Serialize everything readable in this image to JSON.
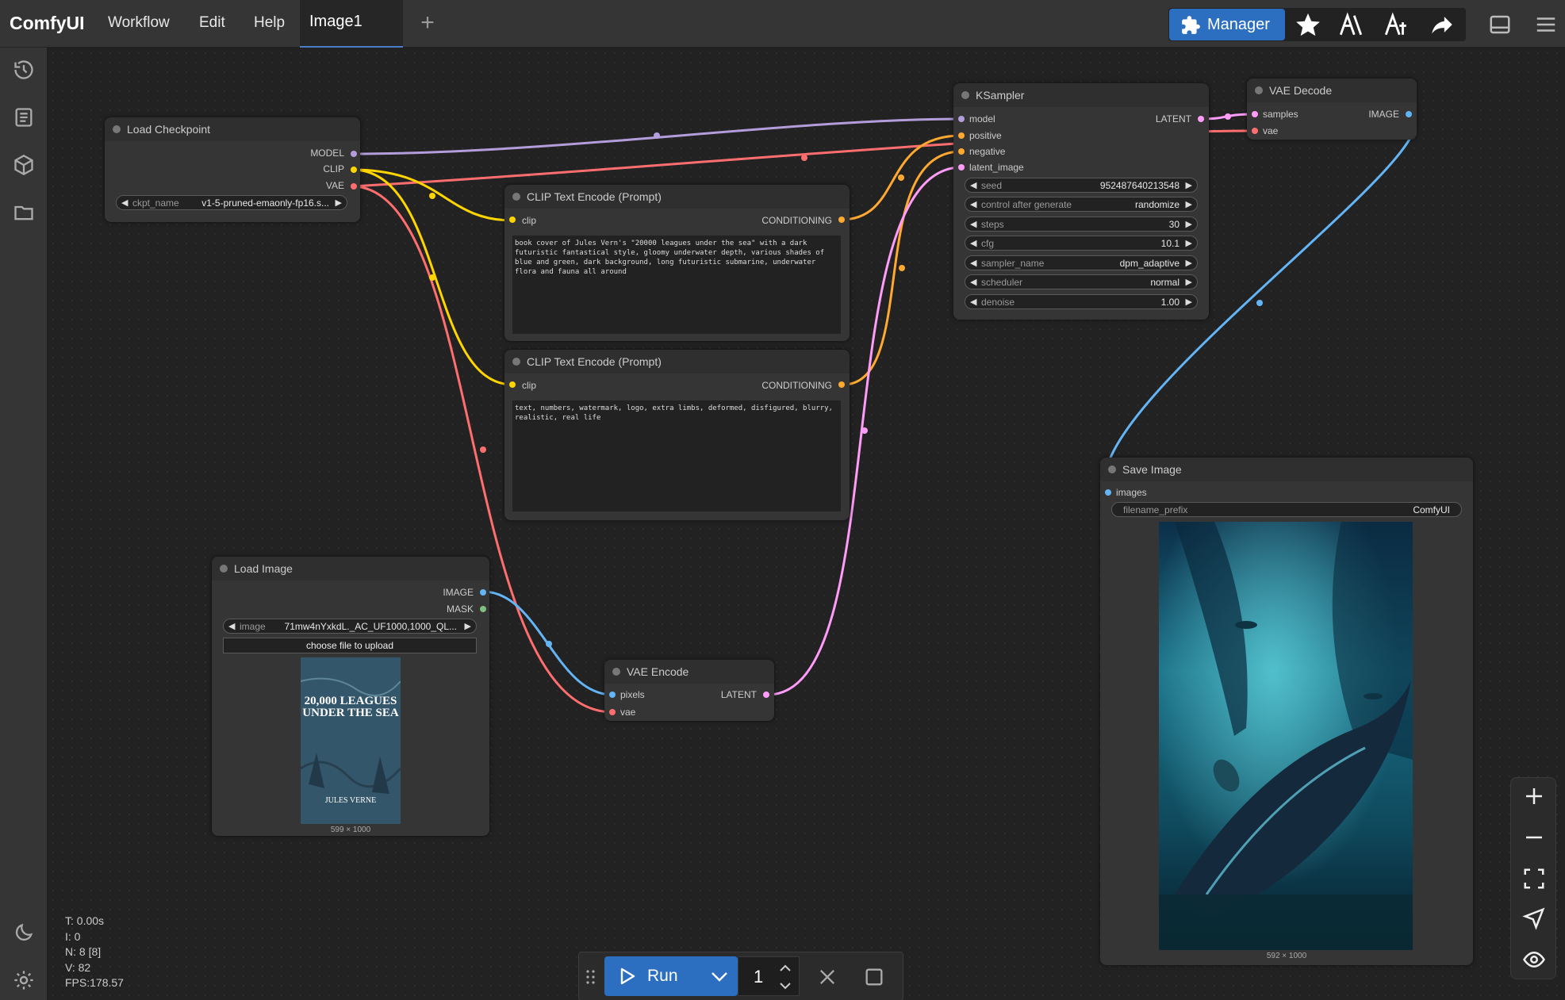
{
  "app": {
    "title": "ComfyUI"
  },
  "menu": [
    "Workflow",
    "Edit",
    "Help"
  ],
  "tabs": [
    {
      "label": "Image1"
    }
  ],
  "toolbar": {
    "manager_label": "Manager"
  },
  "colors": {
    "model": "#b39ddb",
    "clip": "#ffd500",
    "vae": "#ff6e6e",
    "conditioning": "#ffa931",
    "latent": "#ff9cf9",
    "image": "#64b5f6",
    "accent": "#2c6ec0"
  },
  "nodes": {
    "load_checkpoint": {
      "title": "Load Checkpoint",
      "outputs": [
        "MODEL",
        "CLIP",
        "VAE"
      ],
      "ckpt_label": "ckpt_name",
      "ckpt_value": "v1-5-pruned-emaonly-fp16.s..."
    },
    "clip_pos": {
      "title": "CLIP Text Encode (Prompt)",
      "input": "clip",
      "output": "CONDITIONING",
      "text": "book cover of Jules Vern's \"20000 leagues under the sea\" with a dark futuristic fantastical style, gloomy underwater depth, various shades of blue and green, dark background, long futuristic submarine, underwater flora and fauna all around"
    },
    "clip_neg": {
      "title": "CLIP Text Encode (Prompt)",
      "input": "clip",
      "output": "CONDITIONING",
      "text": "text, numbers, watermark, logo, extra limbs, deformed, disfigured, blurry, realistic, real life"
    },
    "ksampler": {
      "title": "KSampler",
      "inputs": [
        "model",
        "positive",
        "negative",
        "latent_image"
      ],
      "output": "LATENT",
      "widgets": [
        {
          "label": "seed",
          "value": "952487640213548"
        },
        {
          "label": "control after generate",
          "value": "randomize"
        },
        {
          "label": "steps",
          "value": "30"
        },
        {
          "label": "cfg",
          "value": "10.1"
        },
        {
          "label": "sampler_name",
          "value": "dpm_adaptive"
        },
        {
          "label": "scheduler",
          "value": "normal"
        },
        {
          "label": "denoise",
          "value": "1.00"
        }
      ]
    },
    "vae_decode": {
      "title": "VAE Decode",
      "inputs": [
        "samples",
        "vae"
      ],
      "output": "IMAGE"
    },
    "save_image": {
      "title": "Save Image",
      "input": "images",
      "prefix_label": "filename_prefix",
      "prefix_value": "ComfyUI",
      "image_dims": "592 × 1000"
    },
    "load_image": {
      "title": "Load Image",
      "outputs": [
        "IMAGE",
        "MASK"
      ],
      "image_label": "image",
      "image_value": "71mw4nYxkdL._AC_UF1000,1000_QL...",
      "upload_label": "choose file to upload",
      "image_dims": "599 × 1000",
      "cover_title": "20,000 LEAGUES UNDER THE SEA",
      "cover_author": "JULES VERNE"
    },
    "vae_encode": {
      "title": "VAE Encode",
      "inputs": [
        "pixels",
        "vae"
      ],
      "output": "LATENT"
    }
  },
  "stats": [
    "T: 0.00s",
    "I: 0",
    "N: 8 [8]",
    "V: 82",
    "FPS:178.57"
  ],
  "runbar": {
    "run_label": "Run",
    "quantity": "1"
  }
}
